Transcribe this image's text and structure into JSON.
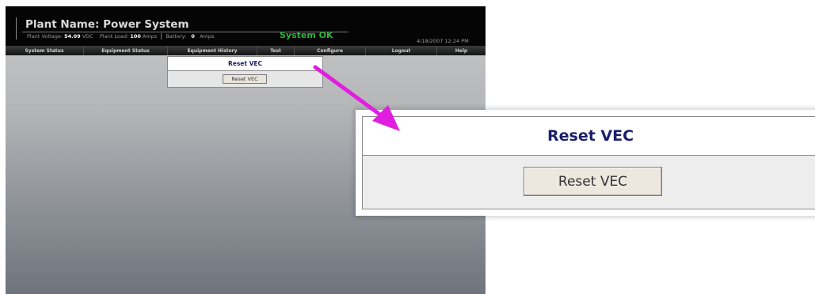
{
  "header": {
    "plant_name_label": "Plant Name:",
    "plant_name": "Power System",
    "plant_voltage_label": "Plant Voltage:",
    "plant_voltage": "54.09",
    "plant_voltage_unit": "VDC",
    "plant_load_label": "Plant Load:",
    "plant_load": "100",
    "plant_load_unit": "Amps",
    "battery_label": "Battery:",
    "battery": "0",
    "battery_unit": "Amps",
    "system_status": "System OK",
    "timestamp": "4/18/2007 12:24 PM"
  },
  "nav": {
    "items": [
      "System Status",
      "Equipment Status",
      "Equipment History",
      "Test",
      "Configure",
      "Logout",
      "Help"
    ]
  },
  "panel": {
    "title": "Reset VEC",
    "button_label": "Reset VEC"
  },
  "zoom": {
    "title": "Reset VEC",
    "button_label": "Reset VEC"
  },
  "colors": {
    "status_ok": "#2db43c",
    "title_text": "#1a1f6a",
    "callout_arrow": "#e11ee0"
  }
}
